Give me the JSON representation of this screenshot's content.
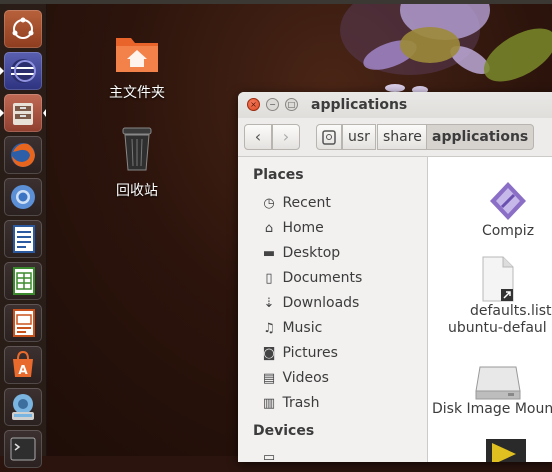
{
  "desktop": {
    "icons": [
      {
        "label": "主文件夹",
        "icon": "home-folder-icon"
      },
      {
        "label": "回收站",
        "icon": "trash-icon"
      }
    ]
  },
  "launcher": {
    "items": [
      {
        "name": "dash-icon"
      },
      {
        "name": "eclipse-icon"
      },
      {
        "name": "files-icon"
      },
      {
        "name": "firefox-icon"
      },
      {
        "name": "chromium-icon"
      },
      {
        "name": "writer-icon"
      },
      {
        "name": "calc-icon"
      },
      {
        "name": "impress-icon"
      },
      {
        "name": "software-center-icon"
      },
      {
        "name": "system-settings-icon"
      },
      {
        "name": "terminal-icon"
      }
    ]
  },
  "window": {
    "title": "applications",
    "path": [
      "usr",
      "share",
      "applications"
    ],
    "places_header": "Places",
    "places": [
      {
        "label": "Recent",
        "icon": "clock-icon"
      },
      {
        "label": "Home",
        "icon": "home-icon"
      },
      {
        "label": "Desktop",
        "icon": "folder-icon"
      },
      {
        "label": "Documents",
        "icon": "document-icon"
      },
      {
        "label": "Downloads",
        "icon": "download-icon"
      },
      {
        "label": "Music",
        "icon": "music-icon"
      },
      {
        "label": "Pictures",
        "icon": "camera-icon"
      },
      {
        "label": "Videos",
        "icon": "film-icon"
      },
      {
        "label": "Trash",
        "icon": "trash-icon"
      }
    ],
    "devices_header": "Devices",
    "files": [
      {
        "name": "Compiz",
        "icon": "compiz-icon"
      },
      {
        "name": "defaults.list.",
        "name2": "ubuntu-defaul",
        "icon": "text-file-icon"
      },
      {
        "name": "Disk Image Moun",
        "icon": "disk-icon"
      }
    ]
  }
}
